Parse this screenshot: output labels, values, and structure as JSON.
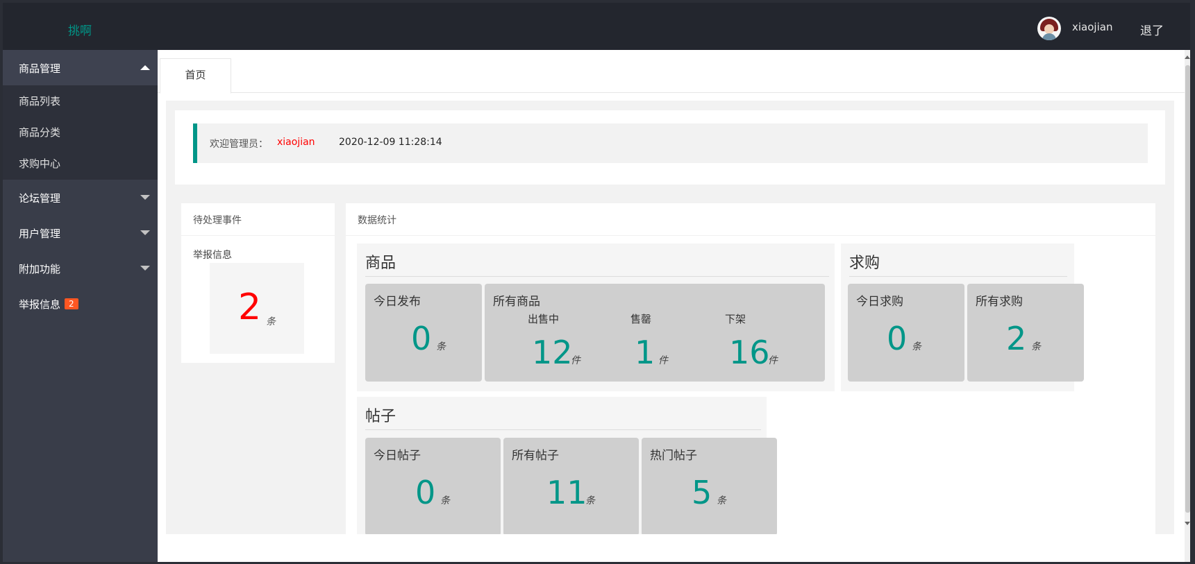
{
  "header": {
    "logo": "挑啊",
    "username": "xiaojian",
    "logout": "退了"
  },
  "sidebar": {
    "groups": [
      {
        "label": "商品管理",
        "expanded": true,
        "items": [
          "商品列表",
          "商品分类",
          "求购中心"
        ]
      },
      {
        "label": "论坛管理",
        "expanded": false
      },
      {
        "label": "用户管理",
        "expanded": false
      },
      {
        "label": "附加功能",
        "expanded": false
      },
      {
        "label": "举报信息",
        "badge": "2"
      }
    ]
  },
  "tabs": [
    {
      "label": "首页"
    }
  ],
  "welcome": {
    "label": "欢迎管理员：",
    "name": "xiaojian",
    "time": "2020-12-09 11:28:14"
  },
  "pending": {
    "title": "待处理事件",
    "item_label": "举报信息",
    "count": "2",
    "unit": "条"
  },
  "stats": {
    "title": "数据统计",
    "goods": {
      "title": "商品",
      "today": {
        "label": "今日发布",
        "value": "0",
        "unit": "条"
      },
      "all": {
        "label": "所有商品",
        "on_sale": {
          "label": "出售中",
          "value": "12",
          "unit": "件"
        },
        "sold_out": {
          "label": "售罄",
          "value": "1",
          "unit": "件"
        },
        "off_shelf": {
          "label": "下架",
          "value": "16",
          "unit": "件"
        }
      }
    },
    "wanted": {
      "title": "求购",
      "today": {
        "label": "今日求购",
        "value": "0",
        "unit": "条"
      },
      "all": {
        "label": "所有求购",
        "value": "2",
        "unit": "条"
      }
    },
    "posts": {
      "title": "帖子",
      "today": {
        "label": "今日帖子",
        "value": "0",
        "unit": "条"
      },
      "all": {
        "label": "所有帖子",
        "value": "11",
        "unit": "条"
      },
      "hot": {
        "label": "热门帖子",
        "value": "5",
        "unit": "条"
      }
    }
  },
  "colors": {
    "header_bg": "#23262e",
    "sidebar_bg": "#393d49",
    "accent": "#009688",
    "alert": "#ff0000",
    "badge": "#ff5722"
  }
}
